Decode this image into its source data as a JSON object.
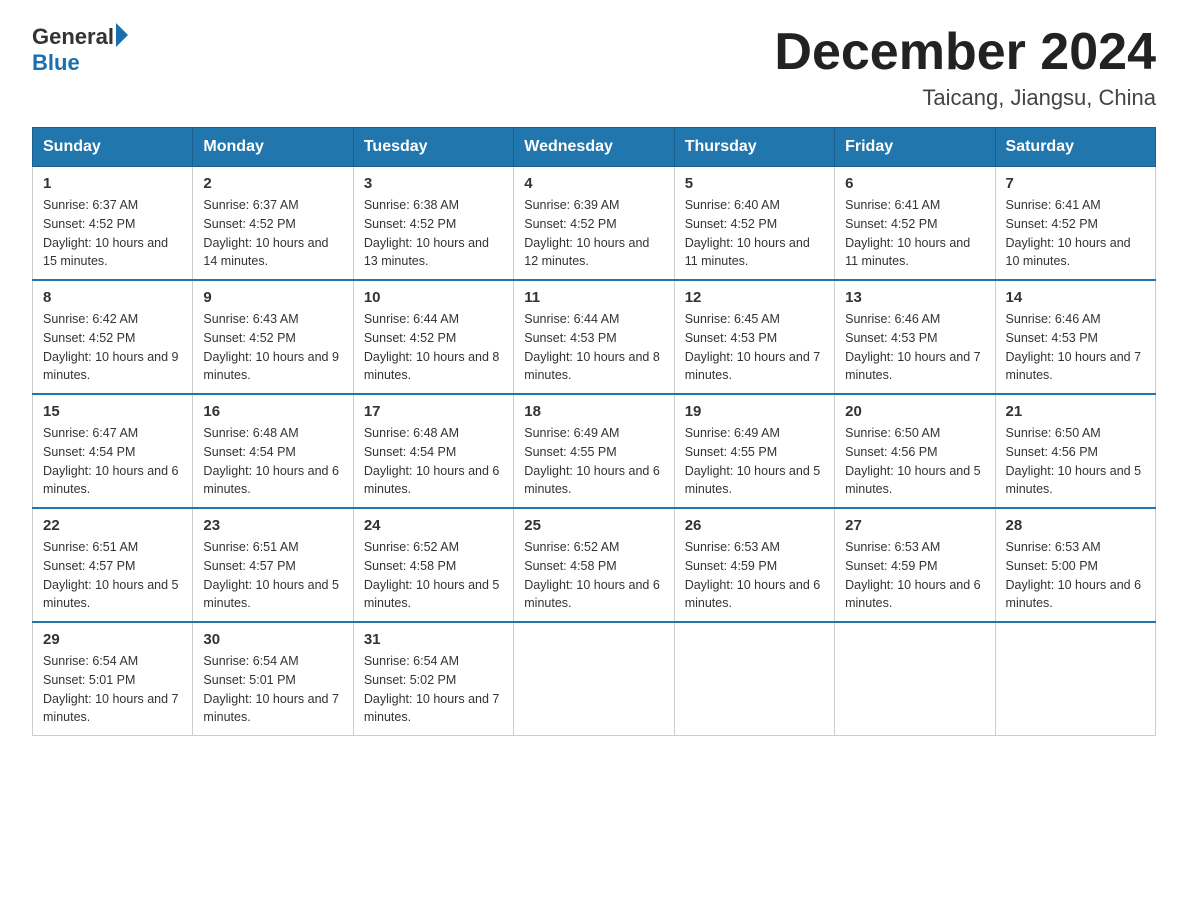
{
  "header": {
    "logo_general": "General",
    "logo_blue": "Blue",
    "title": "December 2024",
    "subtitle": "Taicang, Jiangsu, China"
  },
  "weekdays": [
    "Sunday",
    "Monday",
    "Tuesday",
    "Wednesday",
    "Thursday",
    "Friday",
    "Saturday"
  ],
  "weeks": [
    [
      {
        "day": "1",
        "rise": "6:37 AM",
        "set": "4:52 PM",
        "daylight": "10 hours and 15 minutes."
      },
      {
        "day": "2",
        "rise": "6:37 AM",
        "set": "4:52 PM",
        "daylight": "10 hours and 14 minutes."
      },
      {
        "day": "3",
        "rise": "6:38 AM",
        "set": "4:52 PM",
        "daylight": "10 hours and 13 minutes."
      },
      {
        "day": "4",
        "rise": "6:39 AM",
        "set": "4:52 PM",
        "daylight": "10 hours and 12 minutes."
      },
      {
        "day": "5",
        "rise": "6:40 AM",
        "set": "4:52 PM",
        "daylight": "10 hours and 11 minutes."
      },
      {
        "day": "6",
        "rise": "6:41 AM",
        "set": "4:52 PM",
        "daylight": "10 hours and 11 minutes."
      },
      {
        "day": "7",
        "rise": "6:41 AM",
        "set": "4:52 PM",
        "daylight": "10 hours and 10 minutes."
      }
    ],
    [
      {
        "day": "8",
        "rise": "6:42 AM",
        "set": "4:52 PM",
        "daylight": "10 hours and 9 minutes."
      },
      {
        "day": "9",
        "rise": "6:43 AM",
        "set": "4:52 PM",
        "daylight": "10 hours and 9 minutes."
      },
      {
        "day": "10",
        "rise": "6:44 AM",
        "set": "4:52 PM",
        "daylight": "10 hours and 8 minutes."
      },
      {
        "day": "11",
        "rise": "6:44 AM",
        "set": "4:53 PM",
        "daylight": "10 hours and 8 minutes."
      },
      {
        "day": "12",
        "rise": "6:45 AM",
        "set": "4:53 PM",
        "daylight": "10 hours and 7 minutes."
      },
      {
        "day": "13",
        "rise": "6:46 AM",
        "set": "4:53 PM",
        "daylight": "10 hours and 7 minutes."
      },
      {
        "day": "14",
        "rise": "6:46 AM",
        "set": "4:53 PM",
        "daylight": "10 hours and 7 minutes."
      }
    ],
    [
      {
        "day": "15",
        "rise": "6:47 AM",
        "set": "4:54 PM",
        "daylight": "10 hours and 6 minutes."
      },
      {
        "day": "16",
        "rise": "6:48 AM",
        "set": "4:54 PM",
        "daylight": "10 hours and 6 minutes."
      },
      {
        "day": "17",
        "rise": "6:48 AM",
        "set": "4:54 PM",
        "daylight": "10 hours and 6 minutes."
      },
      {
        "day": "18",
        "rise": "6:49 AM",
        "set": "4:55 PM",
        "daylight": "10 hours and 6 minutes."
      },
      {
        "day": "19",
        "rise": "6:49 AM",
        "set": "4:55 PM",
        "daylight": "10 hours and 5 minutes."
      },
      {
        "day": "20",
        "rise": "6:50 AM",
        "set": "4:56 PM",
        "daylight": "10 hours and 5 minutes."
      },
      {
        "day": "21",
        "rise": "6:50 AM",
        "set": "4:56 PM",
        "daylight": "10 hours and 5 minutes."
      }
    ],
    [
      {
        "day": "22",
        "rise": "6:51 AM",
        "set": "4:57 PM",
        "daylight": "10 hours and 5 minutes."
      },
      {
        "day": "23",
        "rise": "6:51 AM",
        "set": "4:57 PM",
        "daylight": "10 hours and 5 minutes."
      },
      {
        "day": "24",
        "rise": "6:52 AM",
        "set": "4:58 PM",
        "daylight": "10 hours and 5 minutes."
      },
      {
        "day": "25",
        "rise": "6:52 AM",
        "set": "4:58 PM",
        "daylight": "10 hours and 6 minutes."
      },
      {
        "day": "26",
        "rise": "6:53 AM",
        "set": "4:59 PM",
        "daylight": "10 hours and 6 minutes."
      },
      {
        "day": "27",
        "rise": "6:53 AM",
        "set": "4:59 PM",
        "daylight": "10 hours and 6 minutes."
      },
      {
        "day": "28",
        "rise": "6:53 AM",
        "set": "5:00 PM",
        "daylight": "10 hours and 6 minutes."
      }
    ],
    [
      {
        "day": "29",
        "rise": "6:54 AM",
        "set": "5:01 PM",
        "daylight": "10 hours and 7 minutes."
      },
      {
        "day": "30",
        "rise": "6:54 AM",
        "set": "5:01 PM",
        "daylight": "10 hours and 7 minutes."
      },
      {
        "day": "31",
        "rise": "6:54 AM",
        "set": "5:02 PM",
        "daylight": "10 hours and 7 minutes."
      },
      null,
      null,
      null,
      null
    ]
  ]
}
